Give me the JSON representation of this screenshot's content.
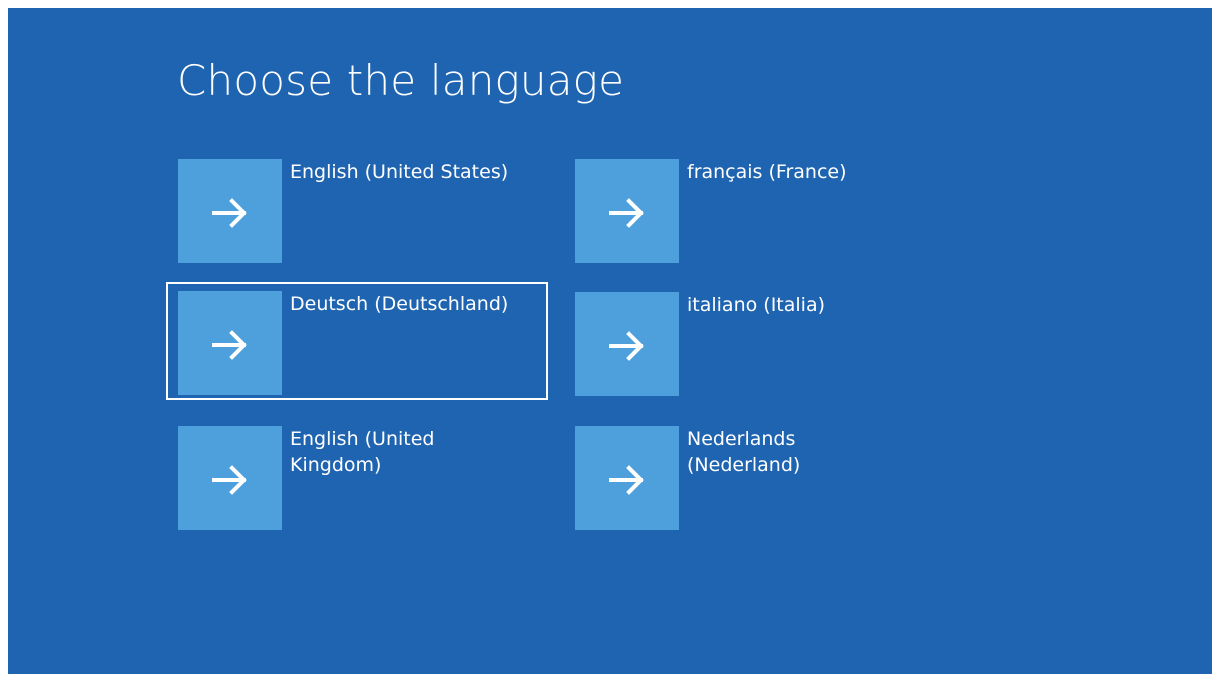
{
  "page": {
    "title": "Choose the language",
    "background_color": "#1f64b0",
    "tile_color": "#4da0dc"
  },
  "languages": [
    {
      "label": "English (United States)",
      "icon": "arrow-right-icon",
      "selected": false
    },
    {
      "label": "Deutsch (Deutschland)",
      "icon": "arrow-right-icon",
      "selected": true
    },
    {
      "label": "English (United\nKingdom)",
      "icon": "arrow-right-icon",
      "selected": false
    },
    {
      "label": "français (France)",
      "icon": "arrow-right-icon",
      "selected": false
    },
    {
      "label": "italiano (Italia)",
      "icon": "arrow-right-icon",
      "selected": false
    },
    {
      "label": "Nederlands\n(Nederland)",
      "icon": "arrow-right-icon",
      "selected": false
    }
  ]
}
